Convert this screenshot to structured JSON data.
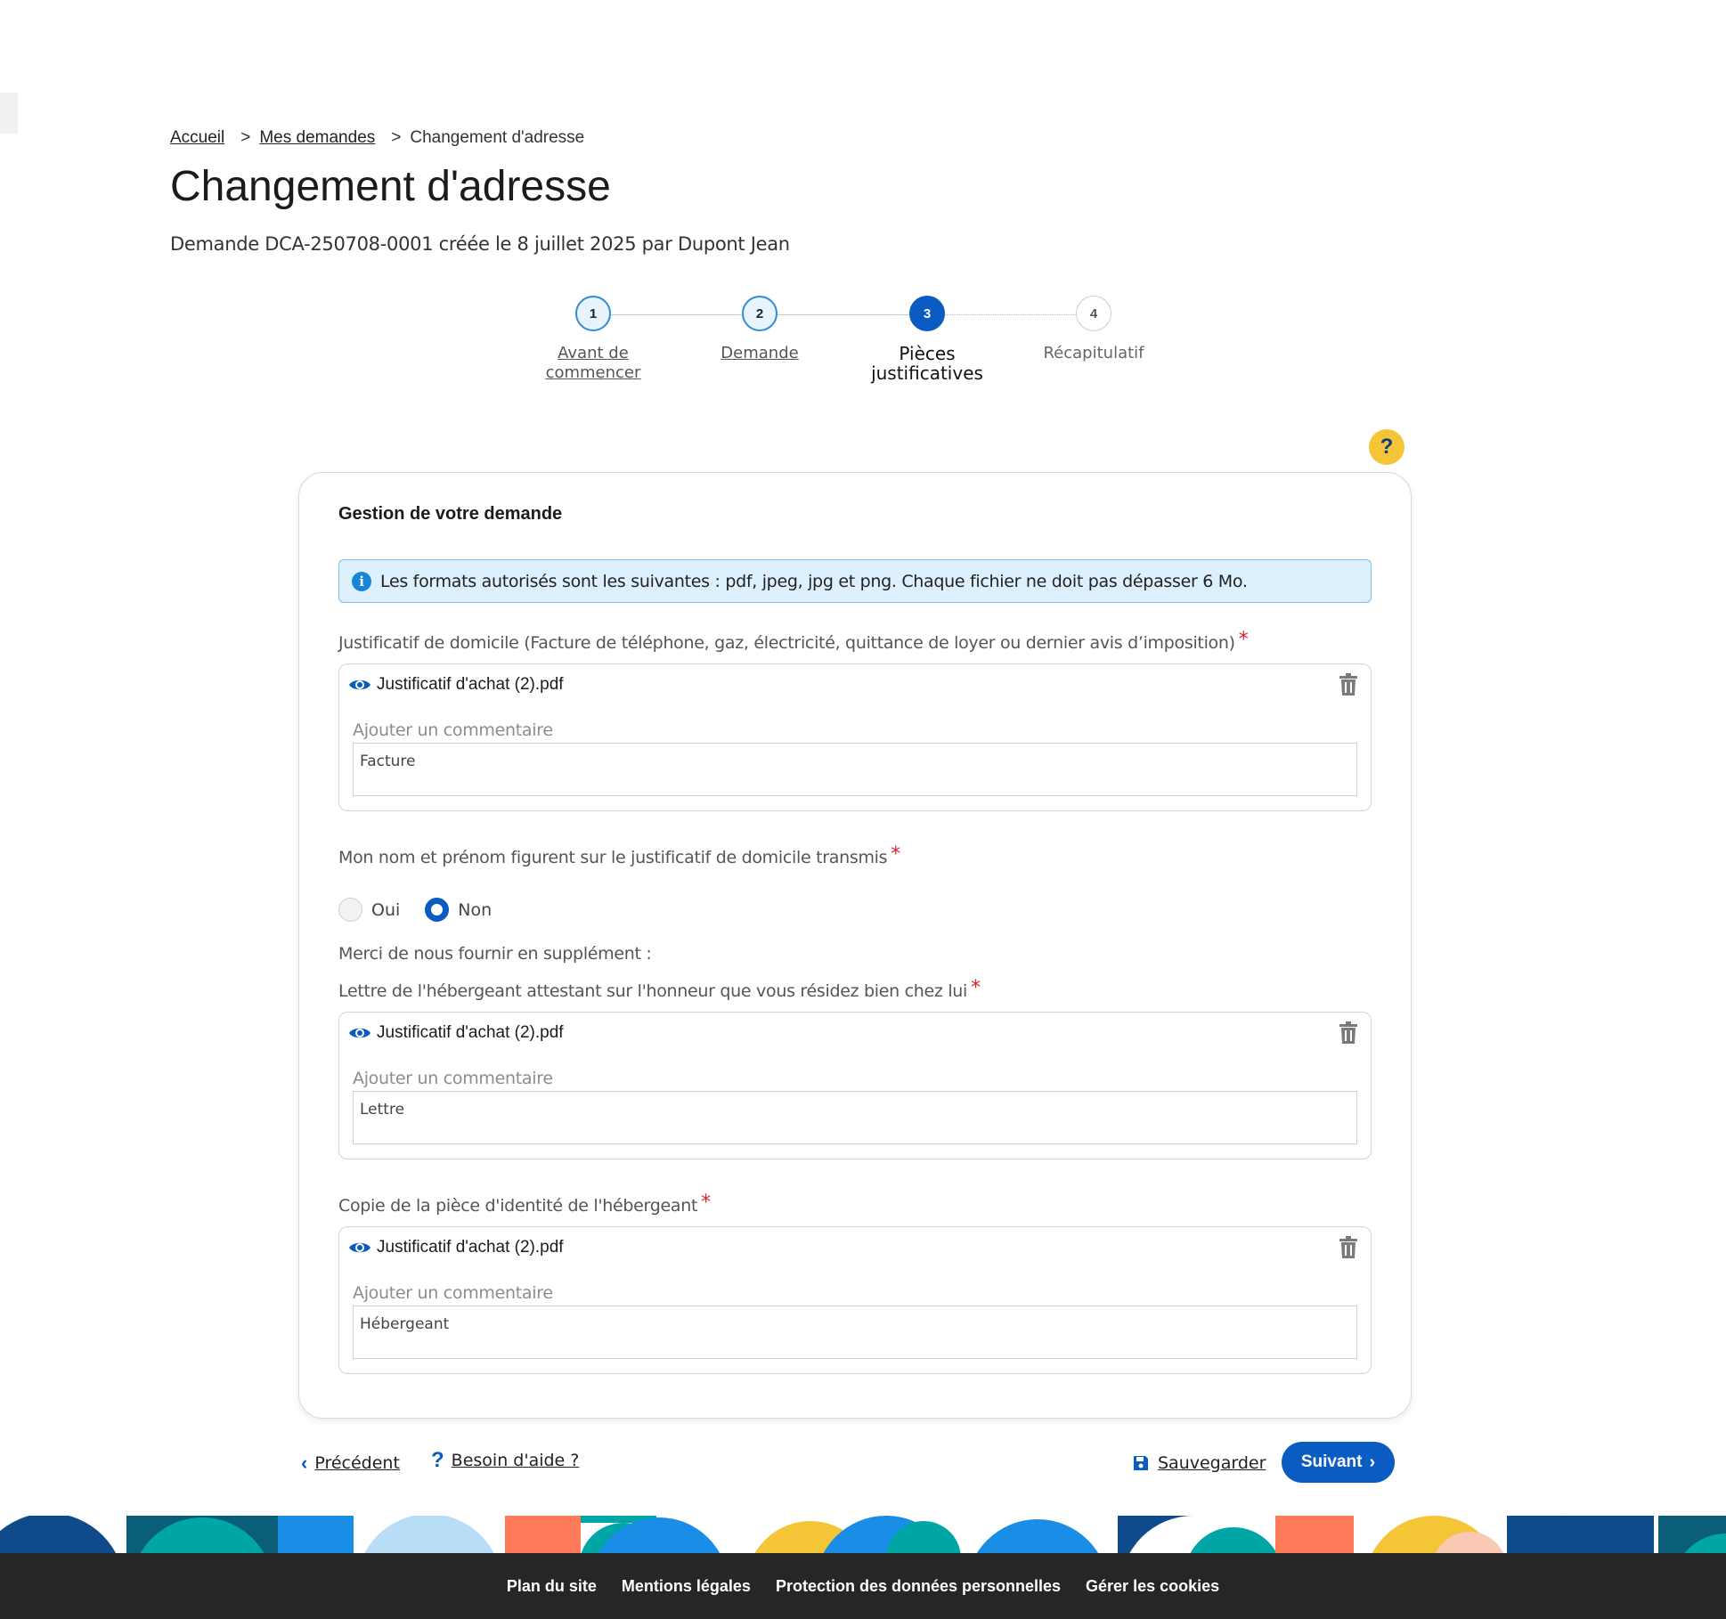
{
  "breadcrumb": {
    "home": "Accueil",
    "requests": "Mes demandes",
    "current": "Changement d'adresse",
    "separator": ">"
  },
  "page": {
    "title": "Changement d'adresse",
    "subtitle": "Demande DCA-250708-0001 créée le 8 juillet 2025 par Dupont Jean"
  },
  "stepper": {
    "steps": [
      {
        "number": "1",
        "label": "Avant de commencer",
        "state": "done"
      },
      {
        "number": "2",
        "label": "Demande",
        "state": "done"
      },
      {
        "number": "3",
        "label": "Pièces justificatives",
        "state": "active"
      },
      {
        "number": "4",
        "label": "Récapitulatif",
        "state": "pending"
      }
    ]
  },
  "help_bubble": "?",
  "card": {
    "title": "Gestion de votre demande",
    "info": "Les formats autorisés sont les suivantes : pdf, jpeg, jpg et png. Chaque fichier ne doit pas dépasser 6 Mo.",
    "info_icon": "i",
    "required_mark": "*",
    "comment_label": "Ajouter un commentaire",
    "field1": {
      "label": "Justificatif de domicile (Facture de téléphone, gaz, électricité, quittance de loyer ou dernier avis d’imposition)",
      "file_name": "Justificatif d'achat (2).pdf",
      "comment": "Facture"
    },
    "question": {
      "label": "Mon nom et prénom figurent sur le justificatif de domicile transmis",
      "options": [
        "Oui",
        "Non"
      ],
      "selected": "Non"
    },
    "supplement_text": "Merci de nous fournir en supplément :",
    "field2": {
      "label": "Lettre de l'hébergeant attestant sur l'honneur que vous résidez bien chez lui",
      "file_name": "Justificatif d'achat (2).pdf",
      "comment": "Lettre"
    },
    "field3": {
      "label": "Copie de la pièce d'identité de l'hébergeant",
      "file_name": "Justificatif d'achat (2).pdf",
      "comment": "Hébergeant"
    }
  },
  "nav": {
    "previous": "Précédent",
    "help": "Besoin d'aide ?",
    "save": "Sauvegarder",
    "next": "Suivant"
  },
  "footer": {
    "links": [
      "Plan du site",
      "Mentions légales",
      "Protection des données personnelles",
      "Gérer les cookies"
    ]
  },
  "colors": {
    "primary": "#0b5cc2",
    "help_bubble": "#f4c537",
    "info_bg": "#ddf0fd",
    "required": "#d0262b",
    "footer_bg": "#262626"
  }
}
